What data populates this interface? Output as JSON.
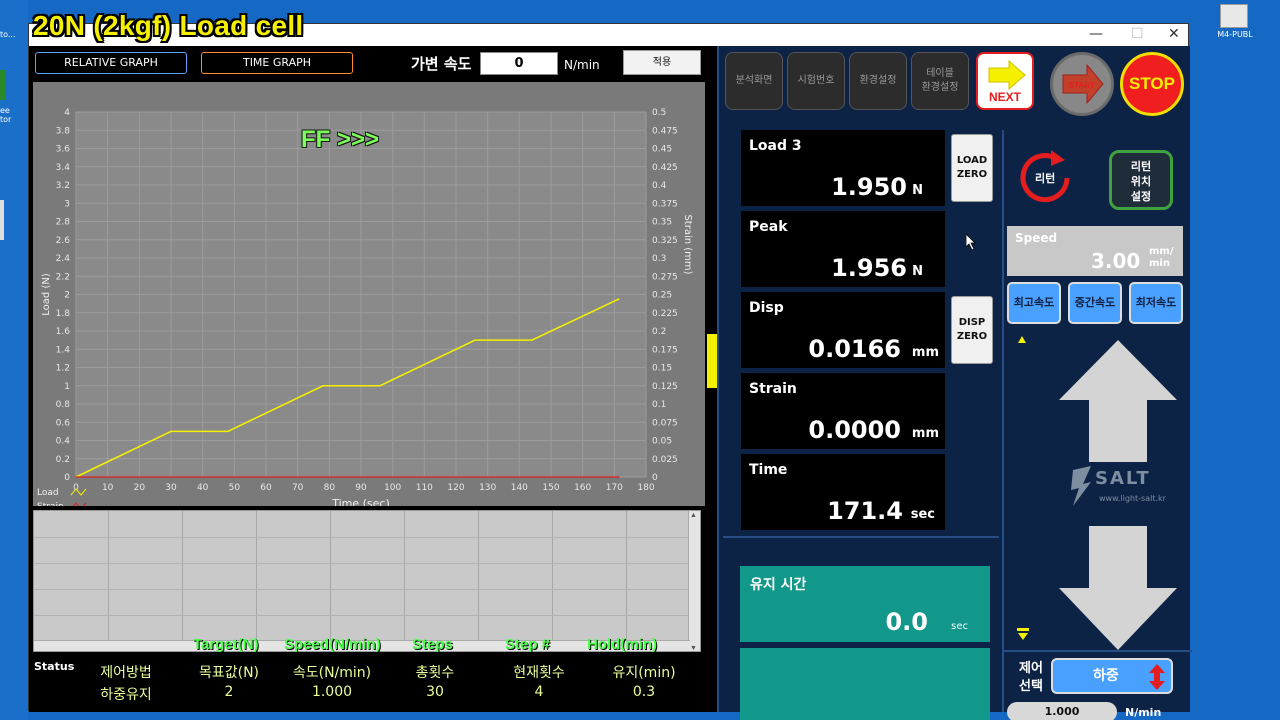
{
  "window": {
    "title": "20N (2kgf) Load cell"
  },
  "desktop": {
    "right_icon_label": "M4-PUBL"
  },
  "graph_tabs": {
    "relative": "RELATIVE GRAPH",
    "time": "TIME GRAPH"
  },
  "variable_speed": {
    "label": "가변 속도",
    "value": "0",
    "unit": "N/min",
    "apply_label": "적용"
  },
  "overlay_label": "FF >>>",
  "chart_data": {
    "type": "line",
    "xlabel": "Time (sec)",
    "ylabel": "Load (N)",
    "y2label": "Strain (mm)",
    "xlim": [
      0,
      180
    ],
    "ylim": [
      0,
      4
    ],
    "y2lim": [
      0,
      0.5
    ],
    "grid": true,
    "legend_placement": "bottom-left",
    "x_ticks": [
      "0",
      "10",
      "20",
      "30",
      "40",
      "50",
      "60",
      "70",
      "80",
      "90",
      "100",
      "110",
      "120",
      "130",
      "140",
      "150",
      "160",
      "170",
      "180"
    ],
    "y_ticks": [
      "0",
      "0.2",
      "0.4",
      "0.6",
      "0.8",
      "1",
      "1.2",
      "1.4",
      "1.6",
      "1.8",
      "2",
      "2.2",
      "2.4",
      "2.6",
      "2.8",
      "3",
      "3.2",
      "3.4",
      "3.6",
      "3.8",
      "4"
    ],
    "y2_ticks": [
      "0",
      "0.025",
      "0.05",
      "0.075",
      "0.1",
      "0.125",
      "0.15",
      "0.175",
      "0.2",
      "0.225",
      "0.25",
      "0.275",
      "0.3",
      "0.325",
      "0.35",
      "0.375",
      "0.4",
      "0.425",
      "0.45",
      "0.475",
      "0.5"
    ],
    "series": [
      {
        "name": "Load",
        "color": "#f4f000",
        "x": [
          0,
          30,
          48,
          78,
          96,
          126,
          144,
          171.4
        ],
        "y": [
          0,
          0.5,
          0.5,
          1.0,
          1.0,
          1.5,
          1.5,
          1.95
        ]
      },
      {
        "name": "Strain",
        "color": "#e02020",
        "x": [
          0,
          171.4
        ],
        "y": [
          0,
          0
        ]
      }
    ]
  },
  "table": {
    "headers": [
      "Target(N)",
      "Speed(N/min)",
      "Steps",
      "Step #",
      "Hold(min)"
    ],
    "status_label": "Status",
    "row1": [
      "제어방법",
      "목표값(N)",
      "속도(N/min)",
      "총횟수",
      "현재횟수",
      "유지(min)"
    ],
    "row2": [
      "하중유지",
      "2",
      "1.000",
      "30",
      "4",
      "0.3"
    ]
  },
  "toolbar": {
    "buttons": [
      "분석화면",
      "시험번호",
      "환경설정",
      "테이블\n환경설정"
    ],
    "next_label": "NEXT",
    "start_label": "START",
    "stop_label": "STOP"
  },
  "readouts": [
    {
      "label": "Load 3",
      "value": "1.950",
      "unit": "N"
    },
    {
      "label": "Peak",
      "value": "1.956",
      "unit": "N"
    },
    {
      "label": "Disp",
      "value": "0.0166",
      "unit": "mm"
    },
    {
      "label": "Strain",
      "value": "0.0000",
      "unit": "mm"
    },
    {
      "label": "Time",
      "value": "171.4",
      "unit": "sec"
    }
  ],
  "zero_buttons": {
    "load": "LOAD\nZERO",
    "disp": "DISP\nZERO"
  },
  "hold_time": {
    "label": "유지 시간",
    "value": "0.0",
    "unit": "sec"
  },
  "return_btn": {
    "label": "리턴"
  },
  "return_pos_btn": {
    "label": "리턴\n위치\n설정"
  },
  "speed": {
    "label": "Speed",
    "value": "3.00",
    "unit": "mm/\nmin"
  },
  "speed_presets": [
    "최고속도",
    "중간속도",
    "최저속도"
  ],
  "brand": {
    "name": "SALT",
    "url": "www.light-salt.kr"
  },
  "control": {
    "label": "제어\n선택",
    "mode": "하중",
    "value": "1.000",
    "unit": "N/min"
  },
  "colors": {
    "accent_yellow": "#f4f000",
    "stop_red": "#f01e1e",
    "teal": "#11988a",
    "preset_blue": "#4aa0ff"
  }
}
